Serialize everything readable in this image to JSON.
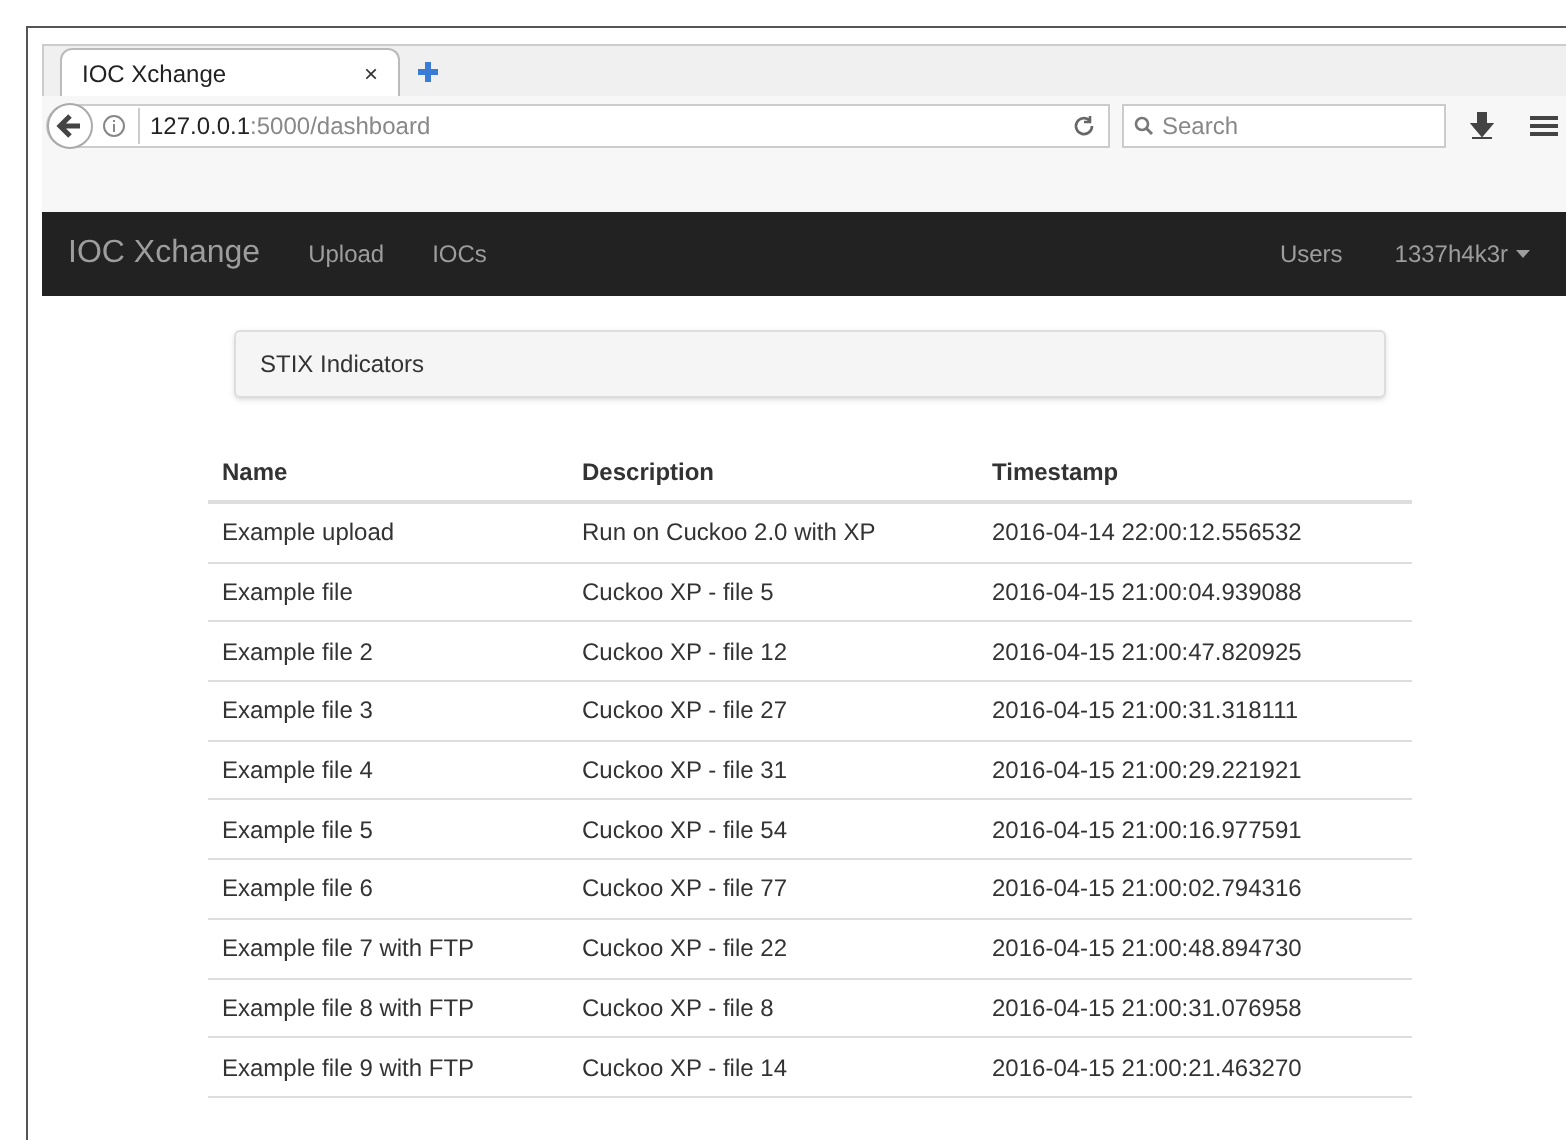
{
  "browser": {
    "tab": {
      "title": "IOC Xchange",
      "close": "×",
      "selected": true
    },
    "url": {
      "host": "127.0.0.1",
      "path": ":5000/dashboard"
    },
    "search": {
      "placeholder": "Search"
    }
  },
  "navbar": {
    "brand": "IOC Xchange",
    "links": [
      "Upload",
      "IOCs"
    ],
    "right_links": [
      "Users"
    ],
    "user": "1337h4k3r"
  },
  "panel": {
    "title": "STIX Indicators"
  },
  "table": {
    "columns": [
      "Name",
      "Description",
      "Timestamp"
    ],
    "rows": [
      [
        "Example upload",
        "Run on Cuckoo 2.0 with XP",
        "2016-04-14 22:00:12.556532"
      ],
      [
        "Example file",
        "Cuckoo XP - file 5",
        "2016-04-15 21:00:04.939088"
      ],
      [
        "Example file 2",
        "Cuckoo XP - file 12",
        "2016-04-15 21:00:47.820925"
      ],
      [
        "Example file 3",
        "Cuckoo XP - file 27",
        "2016-04-15 21:00:31.318111"
      ],
      [
        "Example file 4",
        "Cuckoo XP - file 31",
        "2016-04-15 21:00:29.221921"
      ],
      [
        "Example file 5",
        "Cuckoo XP - file 54",
        "2016-04-15 21:00:16.977591"
      ],
      [
        "Example file 6",
        "Cuckoo XP - file 77",
        "2016-04-15 21:00:02.794316"
      ],
      [
        "Example file 7 with FTP",
        "Cuckoo XP - file 22",
        "2016-04-15 21:00:48.894730"
      ],
      [
        "Example file 8 with FTP",
        "Cuckoo XP - file 8",
        "2016-04-15 21:00:31.076958"
      ],
      [
        "Example file 9 with FTP",
        "Cuckoo XP - file 14",
        "2016-04-15 21:00:21.463270"
      ]
    ]
  }
}
